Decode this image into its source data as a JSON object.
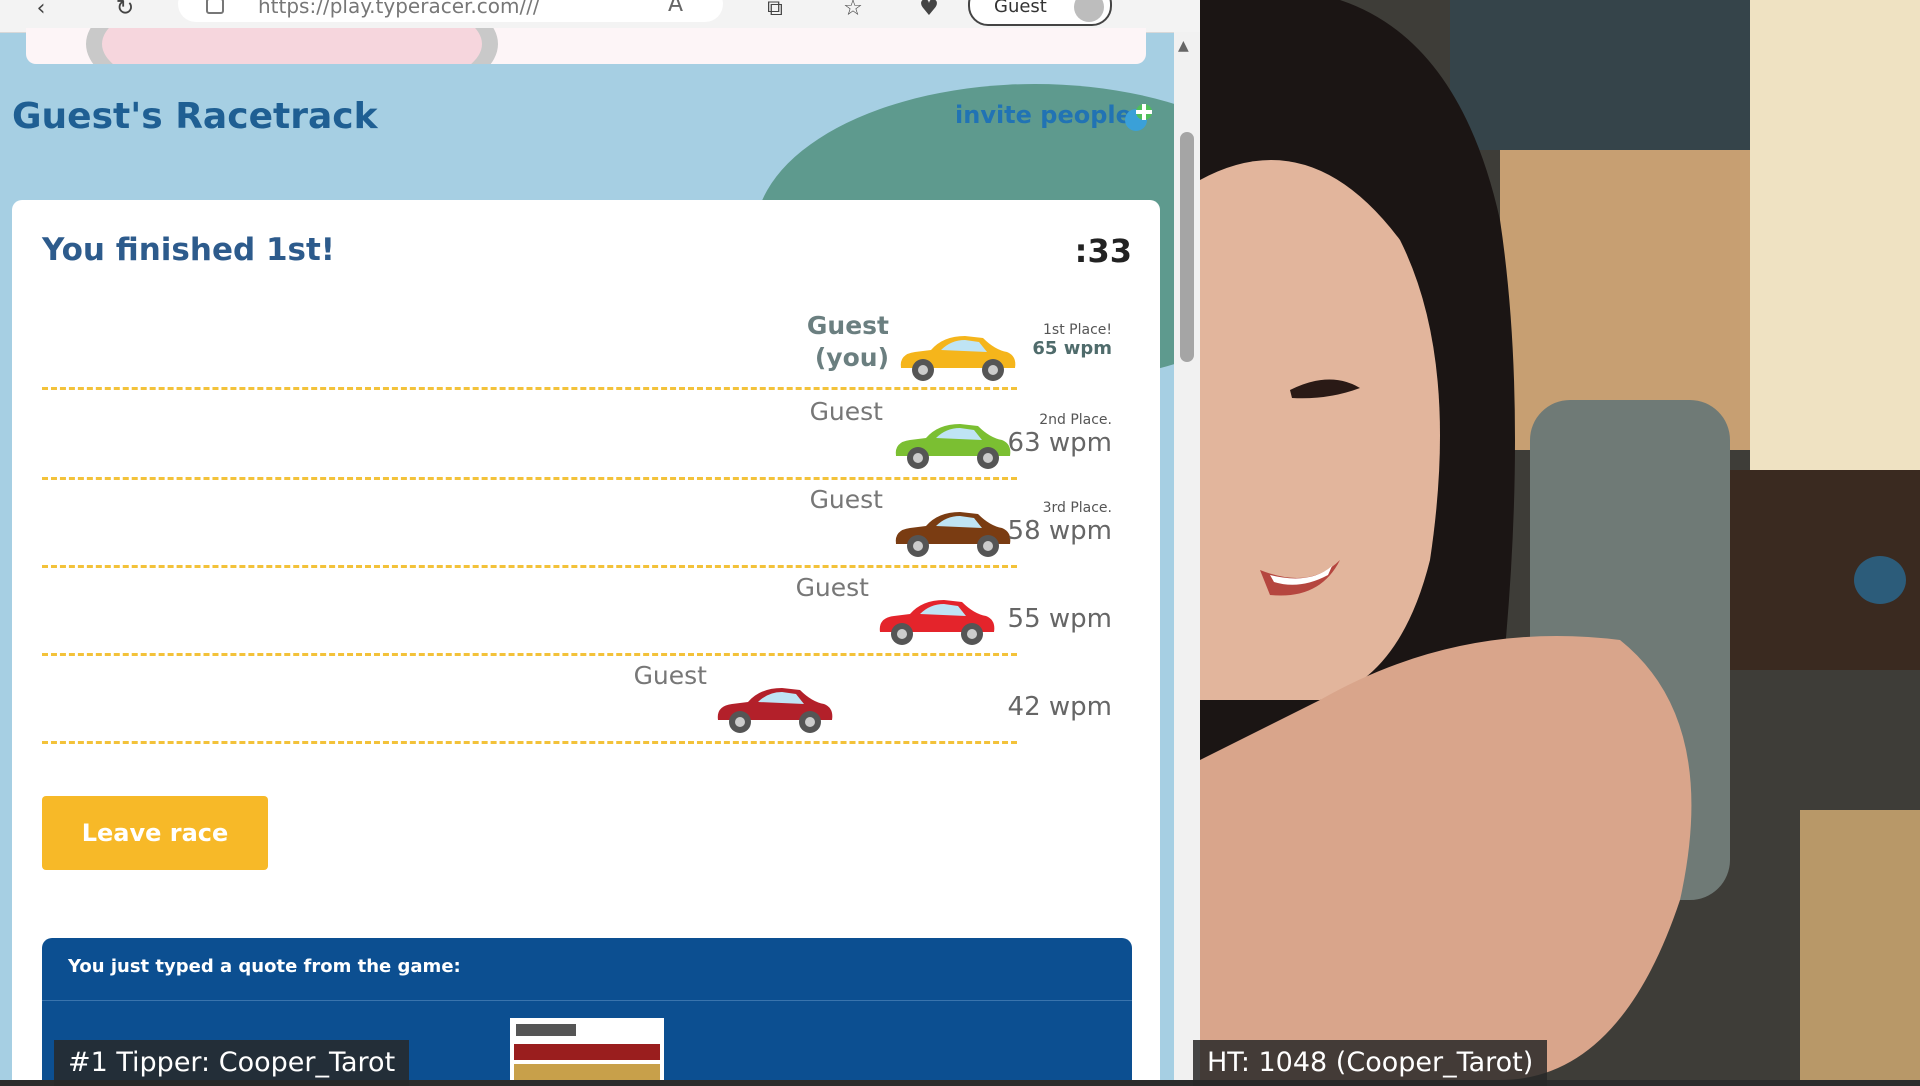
{
  "browser": {
    "url": "https://play.typeracer.com///",
    "profile_label": "Guest"
  },
  "racetrack": {
    "title": "Guest's Racetrack",
    "invite_label": "invite people"
  },
  "results": {
    "heading": "You finished 1st!",
    "timer": ":33",
    "racers": [
      {
        "name": "Guest",
        "name_sub": "(you)",
        "place": "1st Place!",
        "wpm": "65 wpm",
        "car_color": "#f5b51b"
      },
      {
        "name": "Guest",
        "name_sub": "",
        "place": "2nd Place.",
        "wpm": "63 wpm",
        "car_color": "#7bbf32"
      },
      {
        "name": "Guest",
        "name_sub": "",
        "place": "3rd Place.",
        "wpm": "58 wpm",
        "car_color": "#7a3c12"
      },
      {
        "name": "Guest",
        "name_sub": "",
        "place": "",
        "wpm": "55 wpm",
        "car_color": "#e4242b"
      },
      {
        "name": "Guest",
        "name_sub": "",
        "place": "",
        "wpm": "42 wpm",
        "car_color": "#b3202a"
      }
    ],
    "leave_label": "Leave race"
  },
  "quote": {
    "heading": "You just typed a quote from the game:"
  },
  "overlays": {
    "tipper": "#1 Tipper: Cooper_Tarot",
    "ht": "HT: 1048 (Cooper_Tarot)"
  },
  "colors": {
    "accent_blue": "#1f5f93",
    "button_orange": "#f7b928",
    "quote_bg": "#0c4f91",
    "track_dash": "#f3c23a"
  }
}
